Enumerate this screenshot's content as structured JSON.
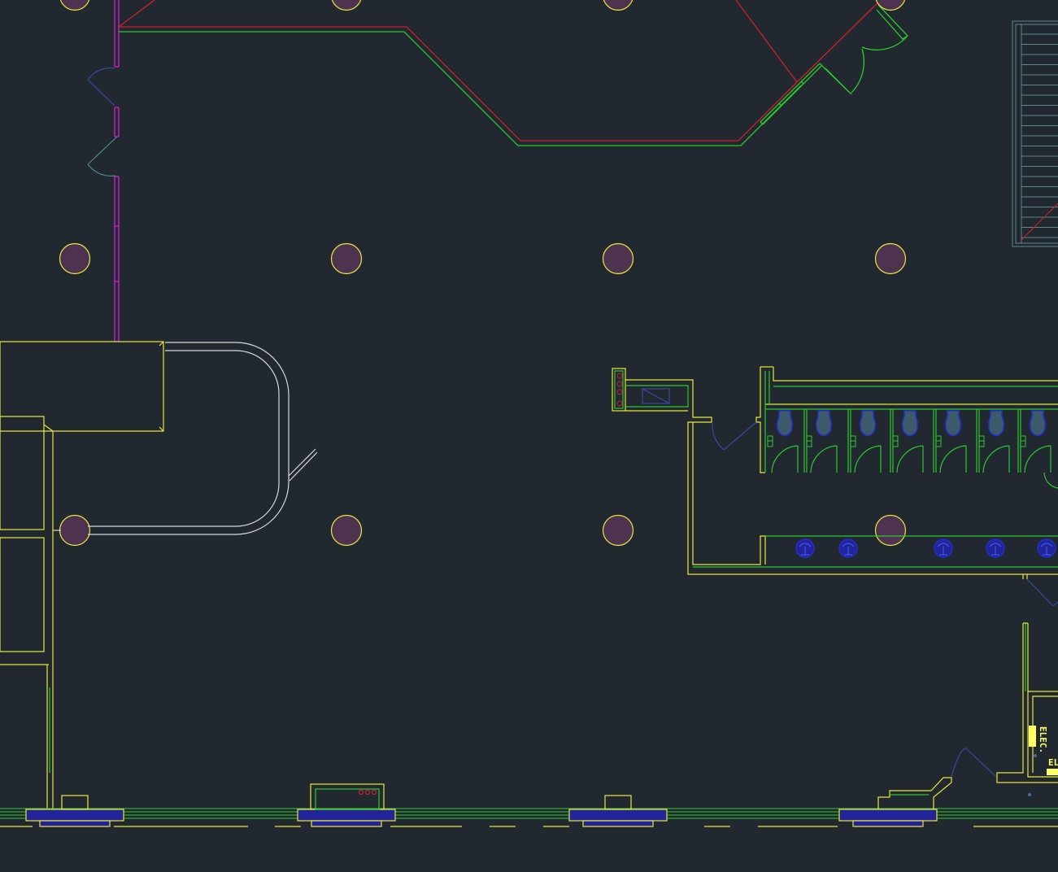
{
  "drawing": {
    "background": "#212830",
    "colors": {
      "wall_yellow": "#e8e83a",
      "wall_green": "#2ec82e",
      "glazing_red": "#d01f2a",
      "partition_magenta": "#e020e0",
      "column_fill": "#4e3350",
      "column_stroke": "#e8e83a",
      "counter_white": "#d8d8d8",
      "fixture_blue": "#2030d0",
      "fixture_fill": "#23239a",
      "door_swing_dark": "#3a4a9a",
      "door_swing_teal": "#4a8a8a",
      "stair_teal": "#5a8a8a",
      "label_yellow": "#ffff66"
    },
    "labels": {
      "electrical_room_1": "ELEC.",
      "electrical_room_2": "EL"
    }
  }
}
